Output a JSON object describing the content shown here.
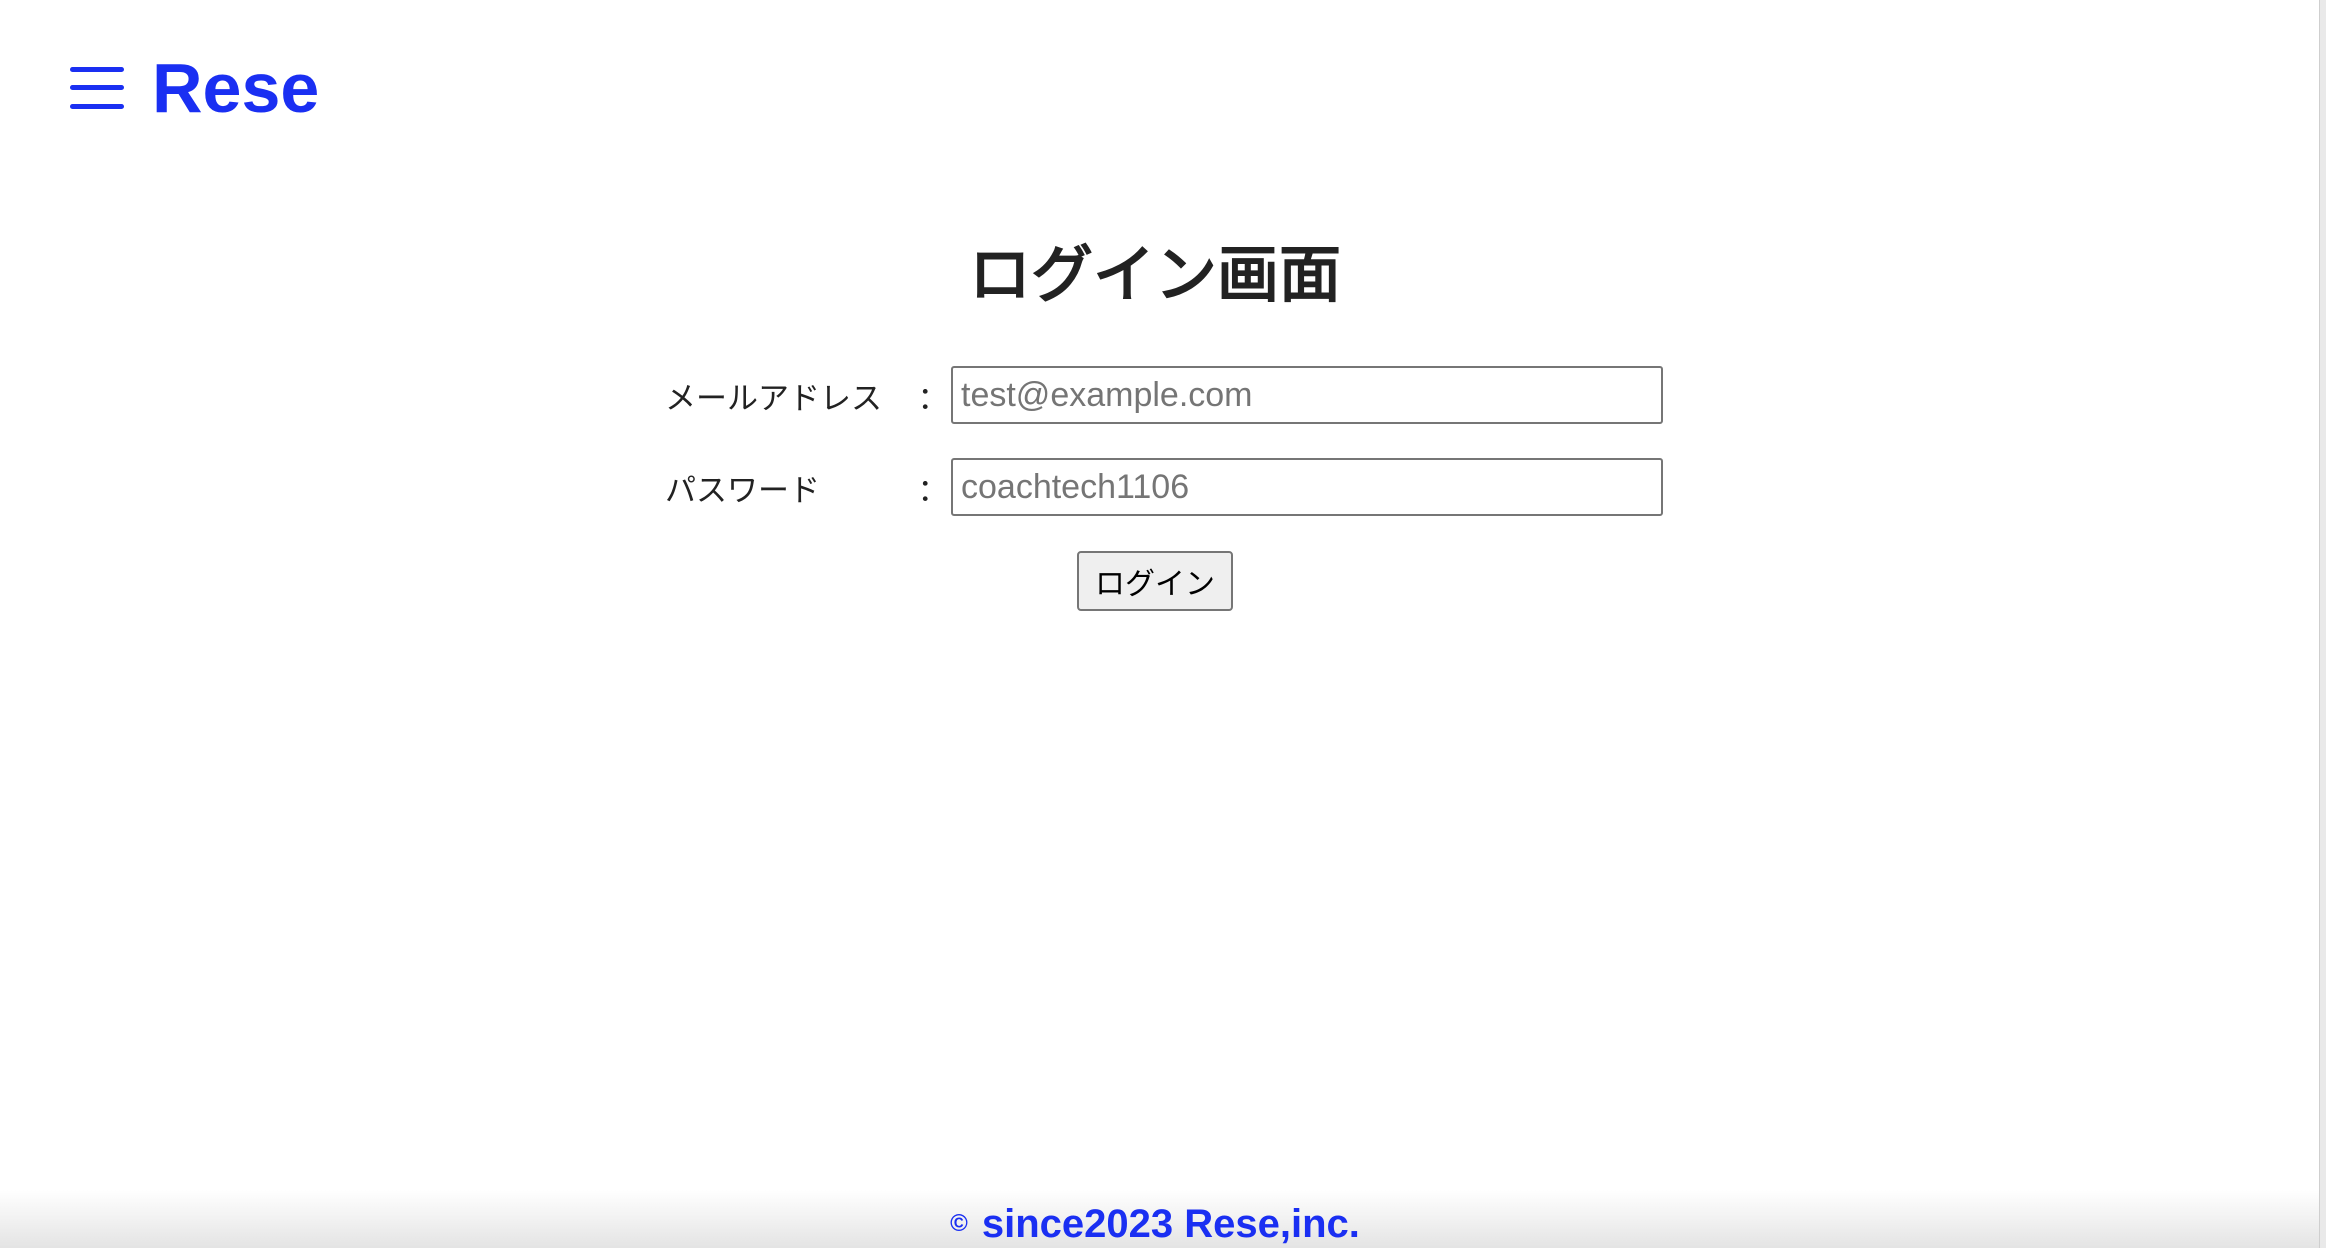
{
  "header": {
    "menu_icon": "hamburger-menu-icon",
    "brand": "Rese"
  },
  "main": {
    "title": "ログイン画面",
    "email": {
      "label": "メールアドレス",
      "colon": "：",
      "value": "",
      "placeholder": "test@example.com"
    },
    "password": {
      "label": "パスワード",
      "colon": "：",
      "value": "",
      "placeholder": "coachtech1106"
    },
    "login_button": "ログイン"
  },
  "footer": {
    "copyright_symbol": "©",
    "text": "since2023 Rese,inc."
  },
  "colors": {
    "brand": "#1a2ff2",
    "text": "#222222",
    "background": "#ffffff"
  }
}
